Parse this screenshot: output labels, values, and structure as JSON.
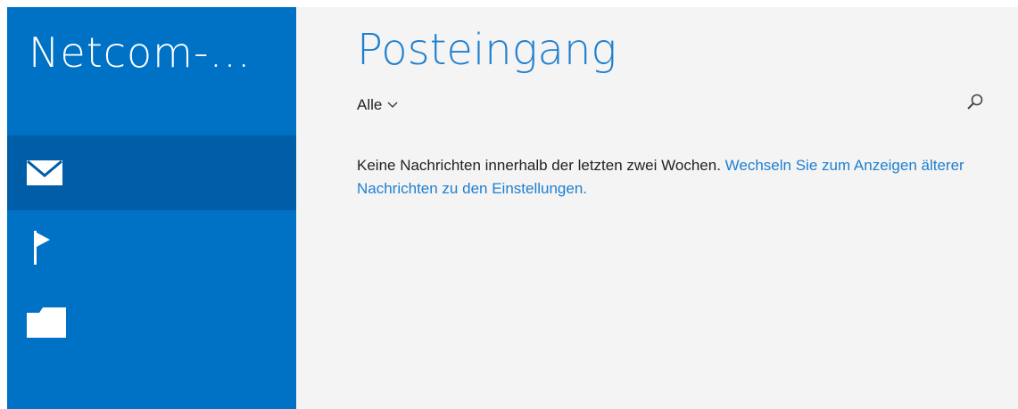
{
  "sidebar": {
    "account_name": "Netcom-...",
    "items": [
      {
        "name": "mail",
        "icon": "mail-icon",
        "active": true
      },
      {
        "name": "flagged",
        "icon": "flag-icon",
        "active": false
      },
      {
        "name": "folders",
        "icon": "folder-icon",
        "active": false
      }
    ]
  },
  "main": {
    "title": "Posteingang",
    "filter_label": "Alle",
    "empty_message": "Keine Nachrichten innerhalb der letzten zwei Wochen.",
    "settings_link": "Wechseln Sie zum Anzeigen älterer Nachrichten zu den Einstellungen."
  },
  "colors": {
    "sidebar_bg": "#0072c6",
    "sidebar_active_bg": "#005ea8",
    "accent": "#1f7fcf",
    "content_bg": "#f4f4f4"
  }
}
